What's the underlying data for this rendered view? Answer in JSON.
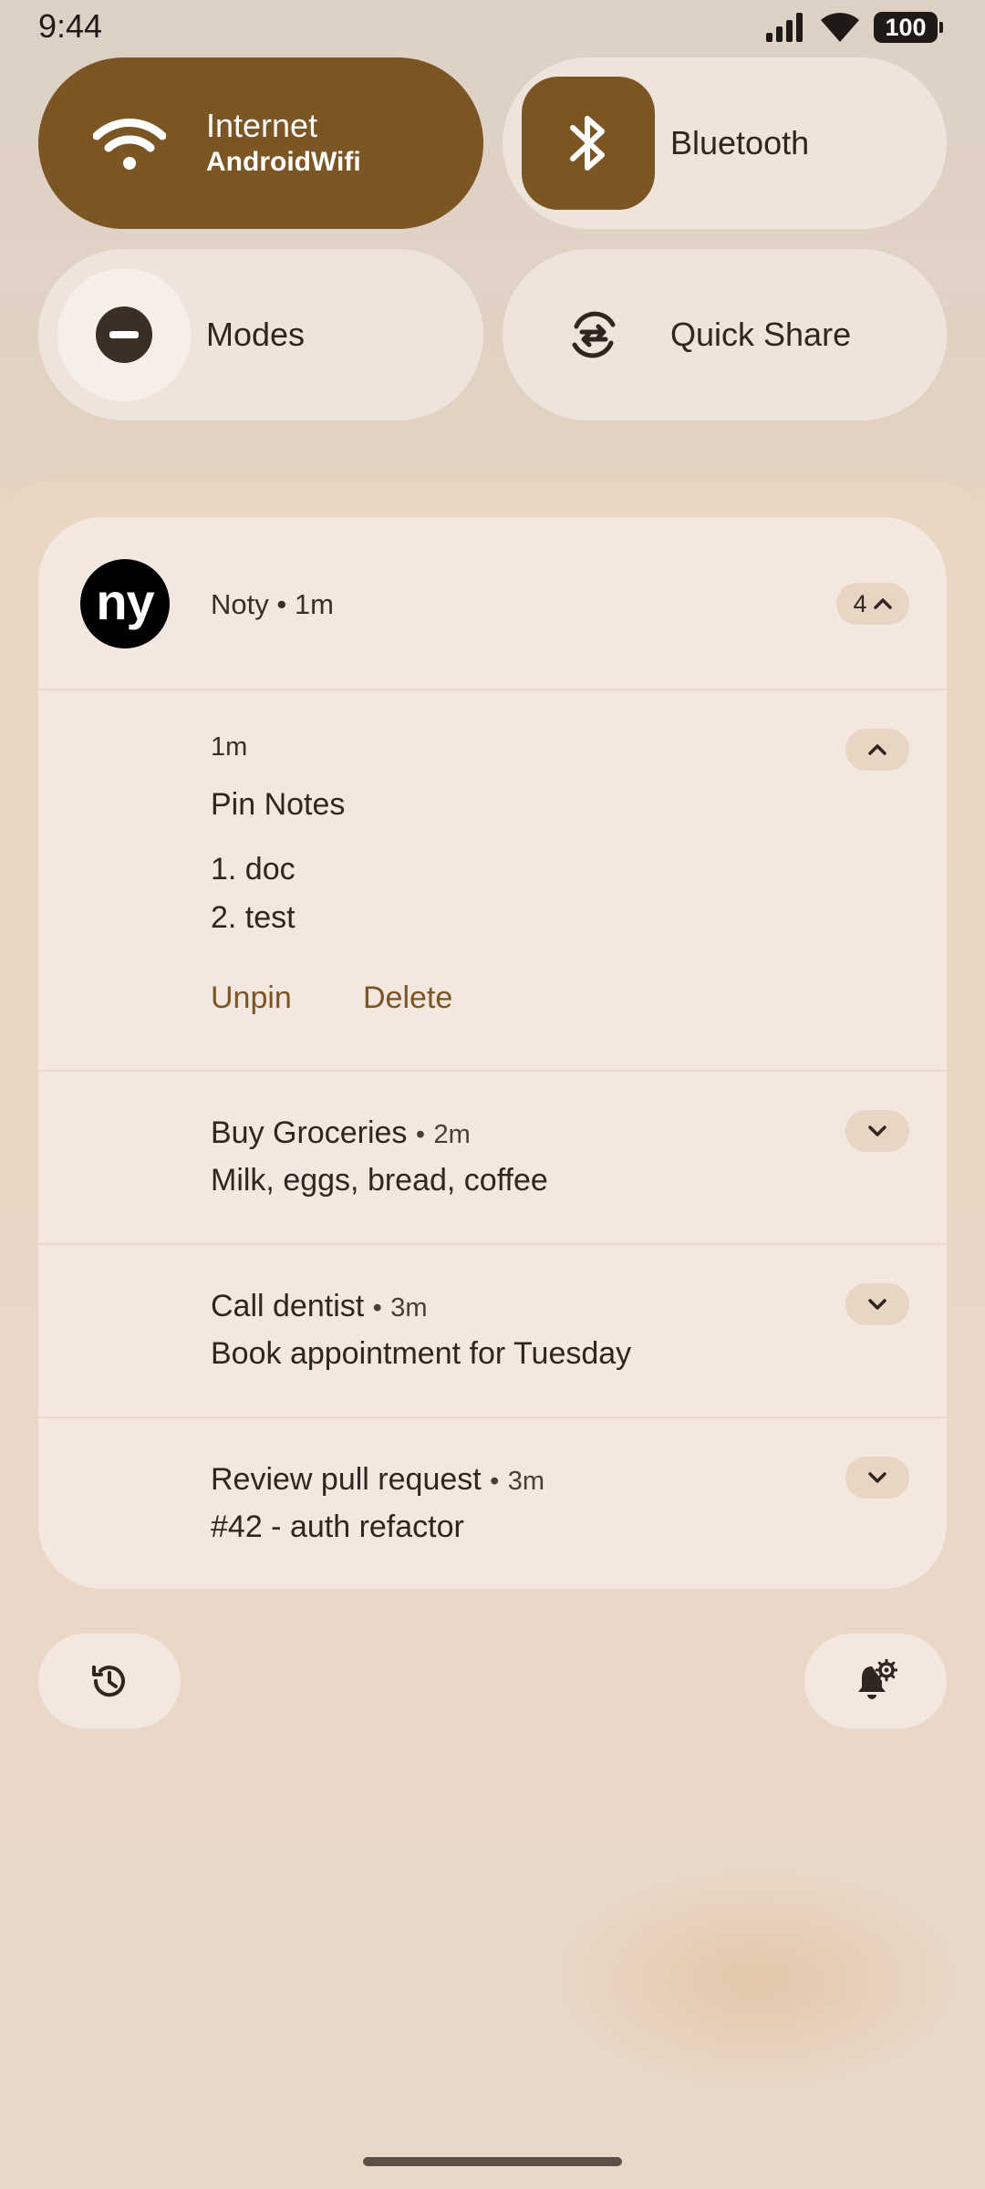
{
  "status_bar": {
    "time": "9:44",
    "battery_level": "100",
    "icons": [
      "signal-icon",
      "wifi-icon",
      "battery-icon"
    ]
  },
  "quick_settings": {
    "internet": {
      "label": "Internet",
      "sublabel": "AndroidWifi",
      "active": true,
      "icon": "wifi-icon"
    },
    "bluetooth": {
      "label": "Bluetooth",
      "active": true,
      "icon": "bluetooth-icon"
    },
    "modes": {
      "label": "Modes",
      "active": false,
      "icon": "do-not-disturb-icon"
    },
    "quick_share": {
      "label": "Quick Share",
      "active": false,
      "icon": "quick-share-icon"
    }
  },
  "notification_group": {
    "app_avatar_text": "ny",
    "app_name": "Noty",
    "separator": "•",
    "app_time": "1m",
    "count": "4",
    "notifications": [
      {
        "time": "1m",
        "title": "Pin Notes",
        "body_lines": [
          "1. doc",
          "2. test"
        ],
        "actions": [
          "Unpin",
          "Delete"
        ],
        "expanded": true
      },
      {
        "title": "Buy Groceries",
        "time": "2m",
        "body": "Milk, eggs, bread, coffee",
        "expanded": false
      },
      {
        "title": "Call dentist",
        "time": "3m",
        "body": "Book appointment for Tuesday",
        "expanded": false
      },
      {
        "title": "Review pull request",
        "time": "3m",
        "body": "#42 - auth refactor",
        "expanded": false
      }
    ]
  },
  "footer": {
    "history_icon": "history-icon",
    "settings_icon": "notification-settings-icon"
  },
  "colors": {
    "accent": "#7c5524",
    "surface": "#f3e7e0",
    "pill": "#e8d5c4",
    "background": "#e8d8c8"
  }
}
